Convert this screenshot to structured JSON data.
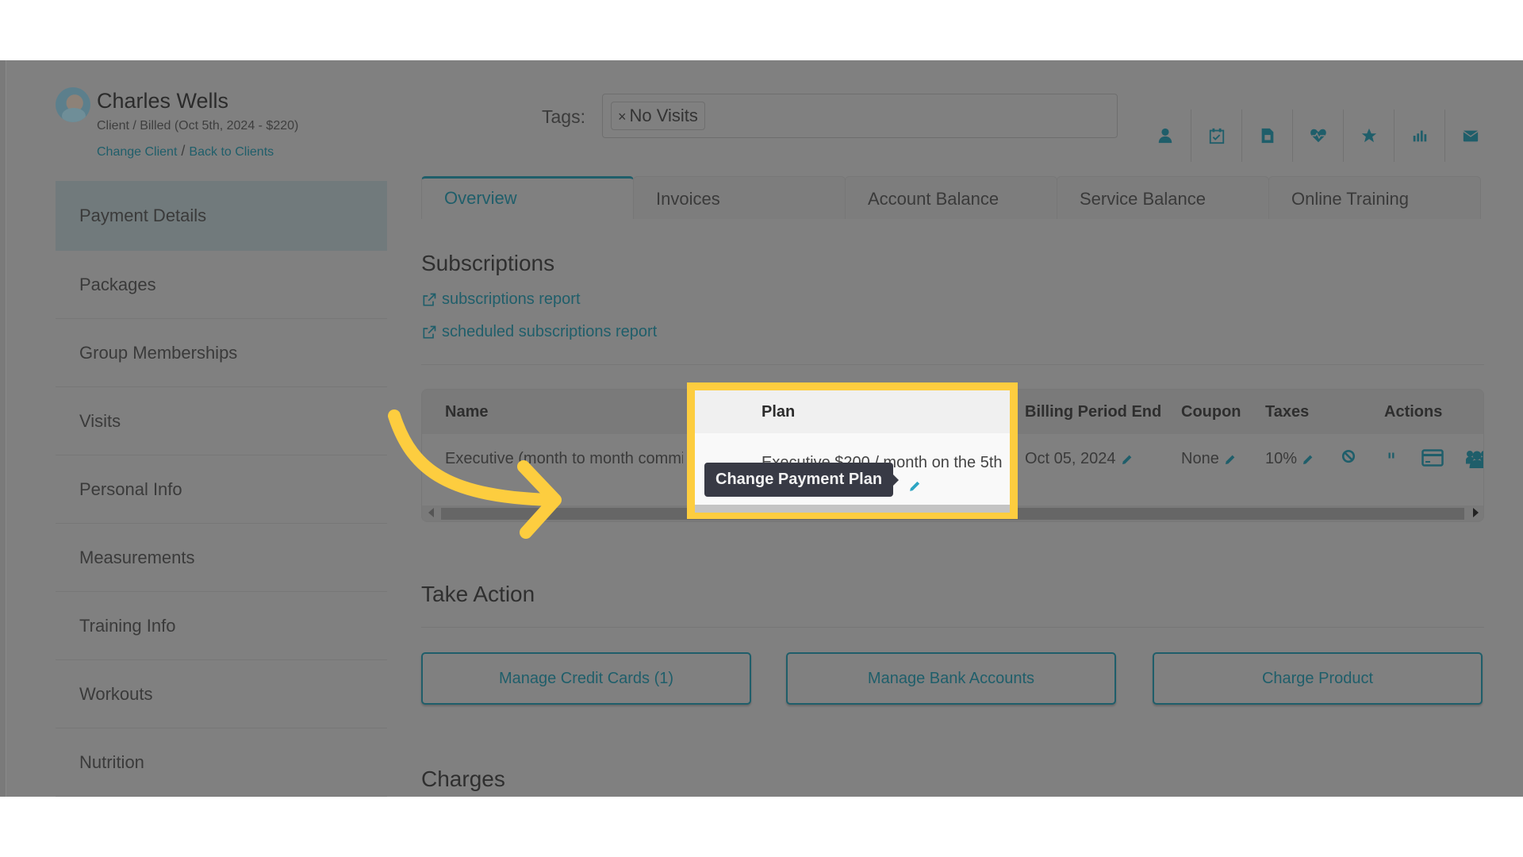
{
  "client": {
    "name": "Charles Wells",
    "status": "Client / Billed (Oct 5th, 2024 - $220)",
    "change_client": "Change Client",
    "separator": "/",
    "back_to_clients": "Back to Clients"
  },
  "tags": {
    "label": "Tags:",
    "chips": [
      {
        "remove": "×",
        "label": "No Visits"
      }
    ]
  },
  "toolbar_icons": [
    "user-icon",
    "calendar-check-icon",
    "document-icon",
    "heartbeat-icon",
    "star-icon",
    "bar-chart-icon",
    "envelope-icon"
  ],
  "sidebar": {
    "items": [
      {
        "label": "Payment Details",
        "active": true
      },
      {
        "label": "Packages"
      },
      {
        "label": "Group Memberships"
      },
      {
        "label": "Visits"
      },
      {
        "label": "Personal Info"
      },
      {
        "label": "Measurements"
      },
      {
        "label": "Training Info"
      },
      {
        "label": "Workouts"
      },
      {
        "label": "Nutrition"
      }
    ]
  },
  "tabs": [
    {
      "label": "Overview",
      "active": true
    },
    {
      "label": "Invoices"
    },
    {
      "label": "Account Balance"
    },
    {
      "label": "Service Balance"
    },
    {
      "label": "Online Training"
    }
  ],
  "subscriptions": {
    "title": "Subscriptions",
    "links": [
      "subscriptions report",
      "scheduled subscriptions report"
    ],
    "table": {
      "columns": [
        "Name",
        "Plan",
        "Billing Period End",
        "Coupon",
        "Taxes",
        "Actions"
      ],
      "rows": [
        {
          "name": "Executive (month to month commitment)",
          "plan": "Executive $200 / month on the 5th",
          "billing_period_end": "Oct 05, 2024",
          "coupon": "None",
          "taxes": "10%",
          "actions": [
            "cancel-icon",
            "pause-icon",
            "credit-card-icon",
            "group-icon"
          ]
        }
      ]
    },
    "tooltip": "Change Payment Plan"
  },
  "take_action": {
    "title": "Take Action",
    "buttons": [
      "Manage Credit Cards (1)",
      "Manage Bank Accounts",
      "Charge Product"
    ]
  },
  "charges": {
    "title": "Charges"
  },
  "colors": {
    "accent": "#1f5e6a",
    "highlight": "#fdcd3f",
    "tooltip_bg": "#383a45",
    "overlay": "#808080"
  }
}
